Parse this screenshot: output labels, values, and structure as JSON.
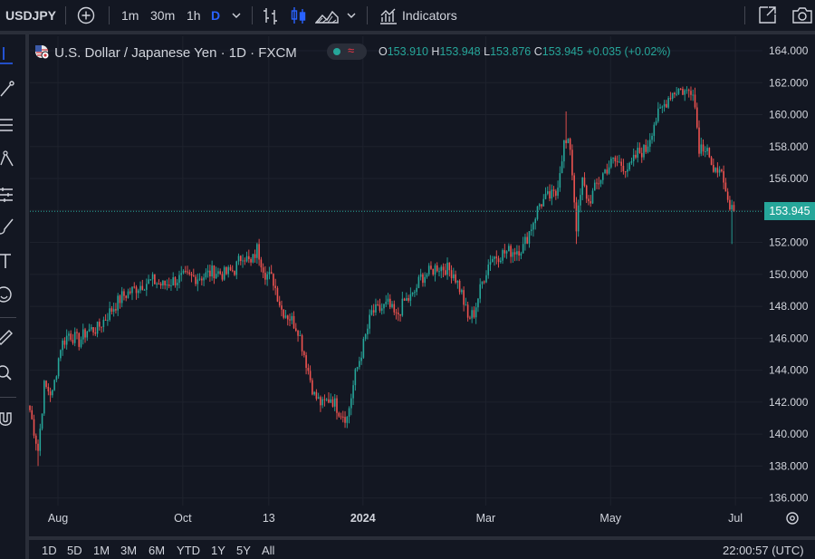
{
  "toolbar": {
    "symbol": "USDJPY",
    "intervals": [
      "1m",
      "30m",
      "1h",
      "D"
    ],
    "active_interval": "D",
    "indicators_label": "Indicators"
  },
  "legend": {
    "title": "U.S. Dollar / Japanese Yen · 1D · FXCM",
    "open_label": "O",
    "open": "153.910",
    "high_label": "H",
    "high": "153.948",
    "low_label": "L",
    "low": "153.876",
    "close_label": "C",
    "close": "153.945",
    "change": "+0.035 (+0.02%)"
  },
  "bottom": {
    "ranges": [
      "1D",
      "5D",
      "1M",
      "3M",
      "6M",
      "YTD",
      "1Y",
      "5Y",
      "All"
    ],
    "clock": "22:00:57 (UTC)"
  },
  "colors": {
    "up": "#26a69a",
    "down": "#ef5350",
    "bg": "#131722",
    "grid": "#1e222d"
  },
  "chart_data": {
    "type": "candlestick",
    "title": "U.S. Dollar / Japanese Yen · 1D · FXCM",
    "y_ticks": [
      "164.000",
      "162.000",
      "160.000",
      "158.000",
      "156.000",
      "154.000",
      "152.000",
      "150.000",
      "148.000",
      "146.000",
      "144.000",
      "142.000",
      "140.000",
      "138.000",
      "136.000"
    ],
    "ylim": [
      135.5,
      164.5
    ],
    "x_ticks": [
      {
        "label": "Aug",
        "day": 4
      },
      {
        "label": "Oct",
        "day": 65
      },
      {
        "label": "13",
        "day": 107
      },
      {
        "label": "2024",
        "day": 153
      },
      {
        "label": "Mar",
        "day": 213
      },
      {
        "label": "May",
        "day": 274
      },
      {
        "label": "Jul",
        "day": 335
      }
    ],
    "last_price": "153.945",
    "close_path": [
      [
        0,
        141.5
      ],
      [
        4,
        139.0
      ],
      [
        7,
        143.0
      ],
      [
        11,
        142.5
      ],
      [
        15,
        145.5
      ],
      [
        19,
        146.3
      ],
      [
        24,
        145.8
      ],
      [
        28,
        146.5
      ],
      [
        33,
        146.6
      ],
      [
        40,
        147.8
      ],
      [
        45,
        148.6
      ],
      [
        50,
        149.0
      ],
      [
        55,
        149.4
      ],
      [
        60,
        149.6
      ],
      [
        65,
        149.3
      ],
      [
        70,
        149.6
      ],
      [
        75,
        149.8
      ],
      [
        80,
        149.8
      ],
      [
        85,
        149.9
      ],
      [
        90,
        150.2
      ],
      [
        95,
        150.0
      ],
      [
        100,
        150.3
      ],
      [
        104,
        151.3
      ],
      [
        108,
        150.6
      ],
      [
        111,
        151.6
      ],
      [
        115,
        150.1
      ],
      [
        119,
        149.6
      ],
      [
        123,
        147.8
      ],
      [
        127,
        147.3
      ],
      [
        131,
        146.6
      ],
      [
        135,
        144.5
      ],
      [
        139,
        142.4
      ],
      [
        143,
        141.8
      ],
      [
        147,
        142.3
      ],
      [
        151,
        141.5
      ],
      [
        155,
        141.0
      ],
      [
        159,
        143.7
      ],
      [
        163,
        145.6
      ],
      [
        167,
        147.6
      ],
      [
        171,
        147.8
      ],
      [
        175,
        148.1
      ],
      [
        179,
        147.3
      ],
      [
        183,
        148.3
      ],
      [
        187,
        148.6
      ],
      [
        191,
        149.8
      ],
      [
        195,
        150.1
      ],
      [
        199,
        150.5
      ],
      [
        203,
        150.4
      ],
      [
        207,
        150.1
      ],
      [
        211,
        148.8
      ],
      [
        214,
        147.2
      ],
      [
        217,
        147.6
      ],
      [
        221,
        149.5
      ],
      [
        225,
        151.0
      ],
      [
        229,
        151.2
      ],
      [
        233,
        151.4
      ],
      [
        237,
        151.5
      ],
      [
        241,
        151.7
      ],
      [
        245,
        153.0
      ],
      [
        249,
        154.4
      ],
      [
        253,
        154.8
      ],
      [
        257,
        155.0
      ],
      [
        261,
        158.2
      ],
      [
        264,
        158.0
      ],
      [
        267,
        153.0
      ],
      [
        270,
        155.8
      ],
      [
        273,
        154.5
      ],
      [
        277,
        155.6
      ],
      [
        281,
        156.5
      ],
      [
        285,
        157.1
      ],
      [
        289,
        156.9
      ],
      [
        293,
        156.6
      ],
      [
        297,
        157.6
      ],
      [
        301,
        157.8
      ],
      [
        305,
        159.5
      ],
      [
        309,
        160.4
      ],
      [
        313,
        161.3
      ],
      [
        317,
        161.6
      ],
      [
        321,
        161.4
      ],
      [
        324,
        161.7
      ],
      [
        327,
        158.0
      ],
      [
        331,
        158.1
      ],
      [
        334,
        156.0
      ],
      [
        337,
        157.0
      ],
      [
        339,
        155.3
      ],
      [
        342,
        154.0
      ],
      [
        344,
        153.945
      ]
    ]
  }
}
